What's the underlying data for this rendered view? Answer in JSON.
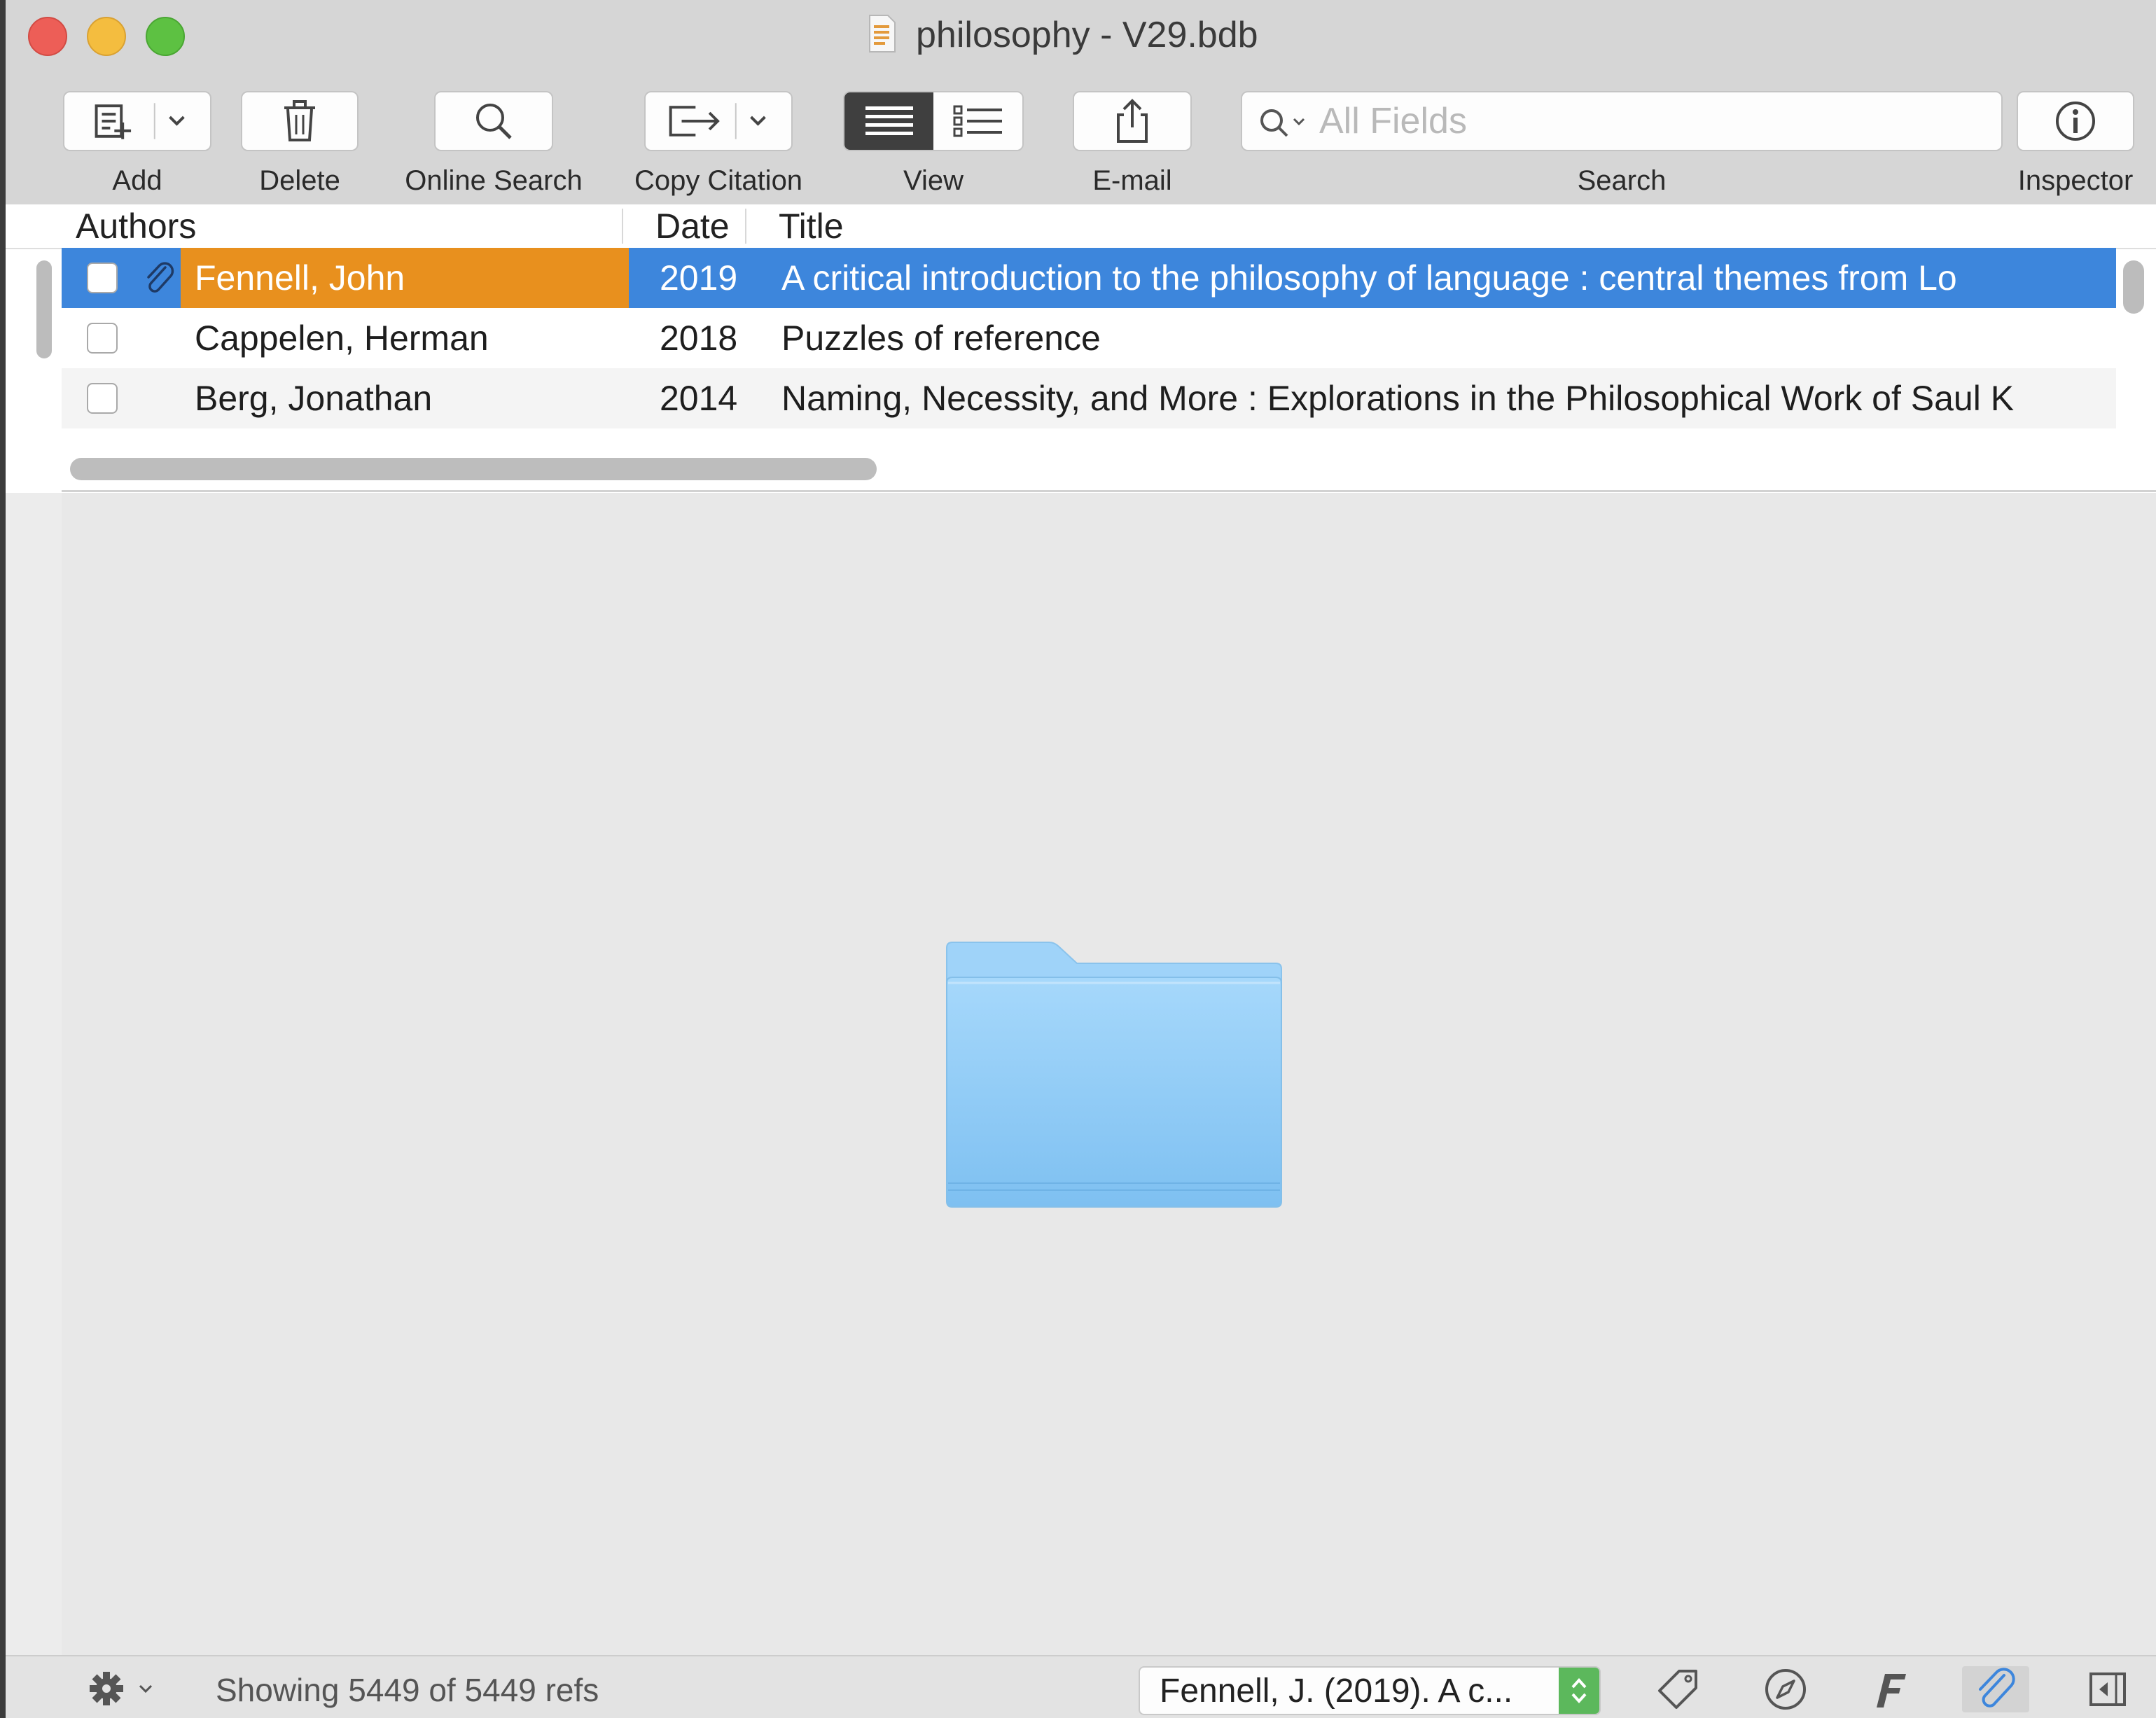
{
  "window": {
    "title": "philosophy - V29.bdb"
  },
  "toolbar": {
    "add_label": "Add",
    "delete_label": "Delete",
    "online_search_label": "Online Search",
    "copy_citation_label": "Copy Citation",
    "view_label": "View",
    "email_label": "E-mail",
    "search_label": "Search",
    "inspector_label": "Inspector",
    "search_placeholder": "All Fields",
    "view_mode": "list"
  },
  "table": {
    "columns": [
      "Authors",
      "Date",
      "Title"
    ],
    "rows": [
      {
        "author": "Fennell, John",
        "date": "2019",
        "title": "A critical introduction to the philosophy of language :   central themes from Lo",
        "selected": true,
        "has_attachment": true
      },
      {
        "author": "Cappelen, Herman",
        "date": "2018",
        "title": "Puzzles of reference",
        "selected": false,
        "has_attachment": false
      },
      {
        "author": "Berg, Jonathan",
        "date": "2014",
        "title": "Naming, Necessity, and More :   Explorations in the Philosophical Work of Saul K",
        "selected": false,
        "has_attachment": false
      }
    ]
  },
  "statusbar": {
    "status_text": "Showing 5449 of 5449 refs",
    "citation_preview": "Fennell, J. (2019). A c...",
    "icons": [
      "gear-icon",
      "tag-icon",
      "compass-icon",
      "font-icon",
      "paperclip-icon",
      "sidebar-toggle-icon"
    ]
  },
  "colors": {
    "selection": "#3d86dc",
    "author_highlight": "#e8901e",
    "folder": "#8ec9f5"
  }
}
